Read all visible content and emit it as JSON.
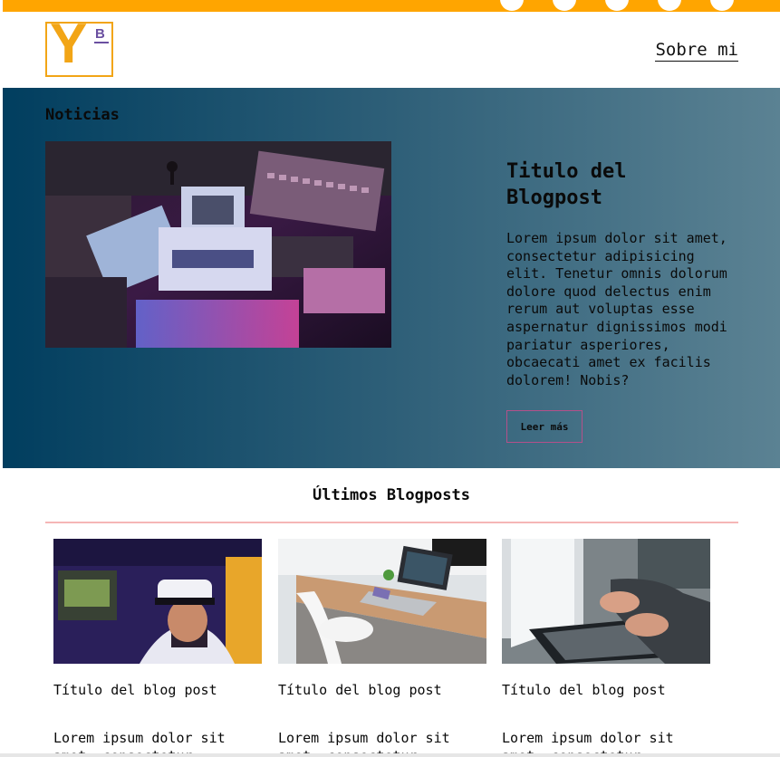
{
  "header": {
    "logo": {
      "letter": "Y",
      "superscript": "B"
    },
    "nav": {
      "about_label": "Sobre mi"
    },
    "social_icons": [
      "social-icon-1",
      "social-icon-2",
      "social-icon-3",
      "social-icon-4",
      "social-icon-5"
    ]
  },
  "hero": {
    "section_label": "Noticias",
    "title": "Titulo del Blogpost",
    "text": "Lorem ipsum dolor sit amet, consectetur adipisicing elit. Tenetur omnis dolorum dolore quod delectus enim rerum aut voluptas esse aspernatur dignissimos modi pariatur asperiores, obcaecati amet ex facilis dolorem! Nobis?",
    "button_label": "Leer más"
  },
  "posts": {
    "section_title": "Últimos Blogposts",
    "items": [
      {
        "title": "Título del blog post",
        "excerpt": "Lorem ipsum dolor sit amet, consectetur adipisicing elit."
      },
      {
        "title": "Título del blog post",
        "excerpt": "Lorem ipsum dolor sit amet, consectetur adipisicing elit."
      },
      {
        "title": "Título del blog post",
        "excerpt": "Lorem ipsum dolor sit amet, consectetur adipisicing elit."
      }
    ]
  },
  "colors": {
    "topbar": "#ffa500",
    "logo": "#f2a516",
    "hero_gradient_start": "#013e5f",
    "hero_gradient_end": "#5b8293",
    "button_border": "#b4508a",
    "divider": "#f5b6b6"
  }
}
